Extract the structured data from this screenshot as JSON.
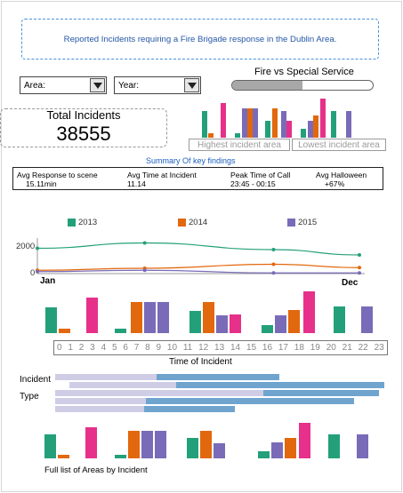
{
  "banner": {
    "text": "Reported Incidents requiring a Fire Brigade response in the Dublin Area."
  },
  "filters": {
    "area_label": "Area:",
    "year_label": "Year:"
  },
  "toggle": {
    "label": "Fire vs Special Service",
    "fire_share": 0.5
  },
  "total": {
    "label": "Total Incidents",
    "value": "38555"
  },
  "area_buttons": {
    "highest": "Highest incident area",
    "lowest": "Lowest incident area"
  },
  "summary": {
    "title": "Summary Of key findings",
    "kpis": [
      {
        "label": "Avg Response to scene",
        "value": "15.11min"
      },
      {
        "label": "Avg Time at Incident",
        "value": "11.14"
      },
      {
        "label": "Peak Time of Call",
        "value": "23:45 - 00:15"
      },
      {
        "label": "Avg Halloween",
        "value": "+67%"
      }
    ]
  },
  "colors": {
    "green": "#23a07a",
    "orange": "#e2680e",
    "purple": "#7a6bb8",
    "pink": "#e6308a",
    "blue": "#6fa4cf",
    "lilac": "#cfcde6"
  },
  "chart_data": [
    {
      "type": "line",
      "legend": [
        "2013",
        "2014",
        "2015"
      ],
      "x_labels": [
        "Jan",
        "Dec"
      ],
      "y_ticks": [
        "2000",
        "0"
      ],
      "ylim": [
        0,
        2800
      ],
      "x": [
        1,
        6,
        12,
        16
      ],
      "series": [
        {
          "name": "2013",
          "values": [
            1900,
            2300,
            1800,
            1400
          ]
        },
        {
          "name": "2014",
          "values": [
            250,
            400,
            700,
            450
          ]
        },
        {
          "name": "2015",
          "values": [
            150,
            250,
            50,
            50
          ]
        }
      ]
    },
    {
      "type": "bar",
      "xlabel": "Time of Incident",
      "hours": [
        "0",
        "1",
        "2",
        "3",
        "4",
        "5",
        "6",
        "7",
        "8",
        "9",
        "10",
        "11",
        "12",
        "13",
        "14",
        "15",
        "16",
        "17",
        "18",
        "19",
        "20",
        "21",
        "22",
        "23"
      ]
    }
  ],
  "incident_type": {
    "label1": "Incident",
    "label2": "Type"
  },
  "footer": {
    "full_list": "Full list of Areas by Incident"
  }
}
